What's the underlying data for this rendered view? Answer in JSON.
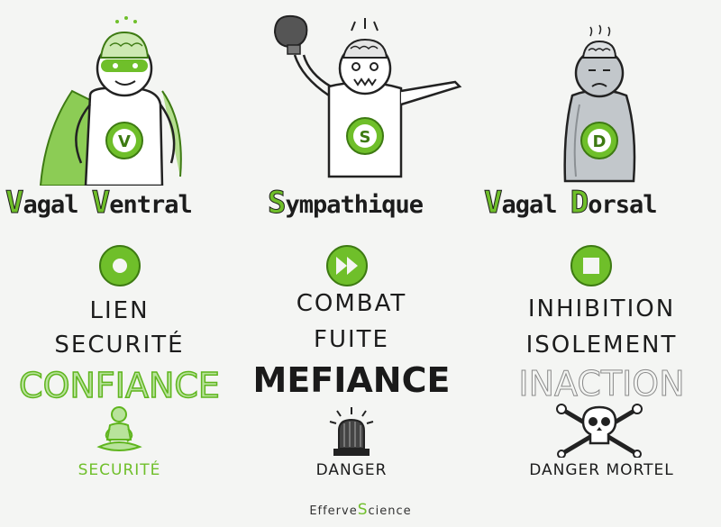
{
  "columns": [
    {
      "id": "vagal-ventral",
      "letter": "V",
      "title_caps": [
        "V",
        "V"
      ],
      "title_rest": [
        "agal ",
        "entral"
      ],
      "mode_icon": "circle-dot-icon",
      "lines": [
        "Lien",
        "Securité"
      ],
      "emphasis": "Confiance",
      "state_icon": "meditating-person-icon",
      "state_label": "Securité"
    },
    {
      "id": "sympathique",
      "letter": "S",
      "title_caps": [
        "S"
      ],
      "title_rest": [
        "ympathique"
      ],
      "mode_icon": "fast-forward-icon",
      "lines": [
        "Combat",
        "Fuite"
      ],
      "emphasis": "Mefiance",
      "state_icon": "alarm-siren-icon",
      "state_label": "Danger"
    },
    {
      "id": "vagal-dorsal",
      "letter": "D",
      "title_caps": [
        "V",
        "D"
      ],
      "title_rest": [
        "agal ",
        "orsal"
      ],
      "mode_icon": "stop-square-icon",
      "lines": [
        "Inhibition",
        "Isolement"
      ],
      "emphasis": "Inaction",
      "state_icon": "skull-crossbones-icon",
      "state_label": "Danger Mortel"
    }
  ],
  "footer": {
    "prefix": "Efferve",
    "accent": "S",
    "suffix": "cience"
  },
  "colors": {
    "green": "#6fbf2a",
    "light_green": "#b8e39b",
    "ink": "#1c1c1c",
    "grey": "#a9acae"
  }
}
